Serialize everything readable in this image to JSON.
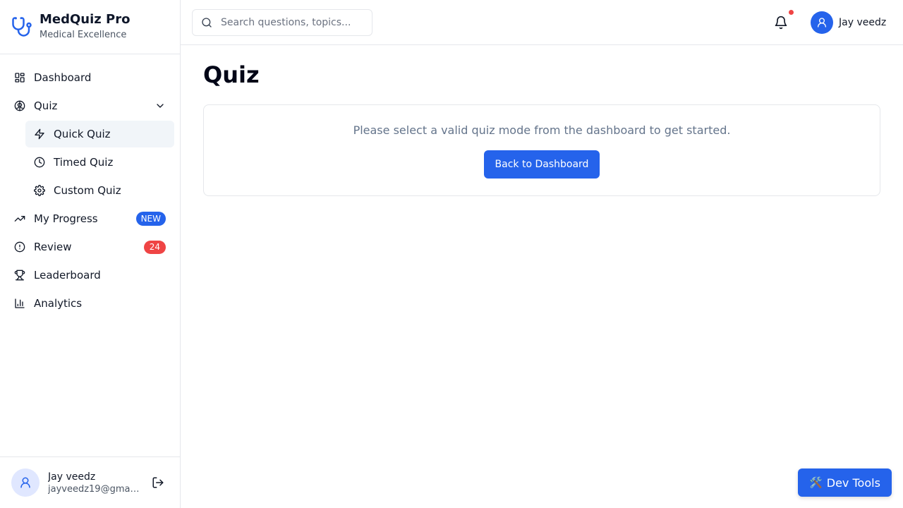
{
  "brand": {
    "title": "MedQuiz Pro",
    "subtitle": "Medical Excellence",
    "icon": "stethoscope-icon",
    "accent": "#2563eb"
  },
  "sidebar": {
    "items": [
      {
        "label": "Dashboard",
        "icon": "layout-grid-icon"
      },
      {
        "label": "Quiz",
        "icon": "brain-icon",
        "expanded": true
      },
      {
        "label": "Quick Quiz",
        "icon": "zap-icon",
        "active": true
      },
      {
        "label": "Timed Quiz",
        "icon": "clock-icon"
      },
      {
        "label": "Custom Quiz",
        "icon": "settings-icon"
      },
      {
        "label": "My Progress",
        "icon": "trending-up-icon",
        "badge": "NEW"
      },
      {
        "label": "Review",
        "icon": "alert-circle-icon",
        "badge": "24"
      },
      {
        "label": "Leaderboard",
        "icon": "trophy-icon"
      },
      {
        "label": "Analytics",
        "icon": "bar-chart-icon"
      }
    ],
    "footer": {
      "name": "Jay veedz",
      "email": "jayveedz19@gmail..."
    }
  },
  "header": {
    "search_placeholder": "Search questions, topics...",
    "user_name": "Jay veedz",
    "has_notification": true
  },
  "main": {
    "title": "Quiz",
    "message": "Please select a valid quiz mode from the dashboard to get started.",
    "button_label": "Back to Dashboard"
  },
  "devtools": {
    "label": "Dev Tools",
    "icon": "🛠️"
  },
  "colors": {
    "primary": "#2563eb",
    "danger": "#ef4444",
    "muted": "#64748b",
    "active_bg": "#f1f5f9"
  }
}
